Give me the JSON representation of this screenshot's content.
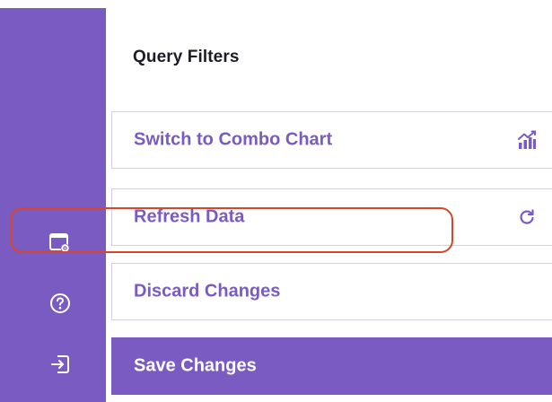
{
  "panel": {
    "title": "Query Filters"
  },
  "menu": {
    "combo_chart_label": "Switch to Combo Chart",
    "refresh_label": "Refresh Data",
    "discard_label": "Discard Changes",
    "save_label": "Save Changes"
  },
  "icons": {
    "combo_chart": "chart-icon",
    "refresh": "refresh-icon",
    "settings": "window-settings-icon",
    "help": "help-icon",
    "logout": "exit-icon"
  },
  "colors": {
    "accent": "#7a5bc1",
    "highlight": "#d9452b",
    "item_border": "#d3cde6",
    "title_text": "#1c1c28"
  }
}
